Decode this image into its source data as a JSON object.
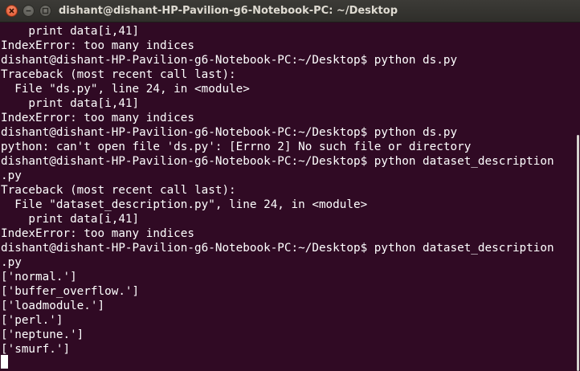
{
  "window": {
    "title": "dishant@dishant-HP-Pavilion-g6-Notebook-PC: ~/Desktop"
  },
  "terminal": {
    "lines": [
      "    print data[i,41]",
      "IndexError: too many indices",
      "dishant@dishant-HP-Pavilion-g6-Notebook-PC:~/Desktop$ python ds.py",
      "Traceback (most recent call last):",
      "  File \"ds.py\", line 24, in <module>",
      "    print data[i,41]",
      "IndexError: too many indices",
      "dishant@dishant-HP-Pavilion-g6-Notebook-PC:~/Desktop$ python ds.py",
      "python: can't open file 'ds.py': [Errno 2] No such file or directory",
      "dishant@dishant-HP-Pavilion-g6-Notebook-PC:~/Desktop$ python dataset_description",
      ".py",
      "Traceback (most recent call last):",
      "  File \"dataset_description.py\", line 24, in <module>",
      "    print data[i,41]",
      "IndexError: too many indices",
      "dishant@dishant-HP-Pavilion-g6-Notebook-PC:~/Desktop$ python dataset_description",
      ".py",
      "['normal.']",
      "['buffer_overflow.']",
      "['loadmodule.']",
      "['perl.']",
      "['neptune.']",
      "['smurf.']"
    ]
  },
  "colors": {
    "background": "#300a24",
    "foreground": "#ffffff",
    "close_button": "#e0502b"
  },
  "icons": {
    "close": "close-icon",
    "minimize": "minimize-icon",
    "maximize": "maximize-icon"
  }
}
